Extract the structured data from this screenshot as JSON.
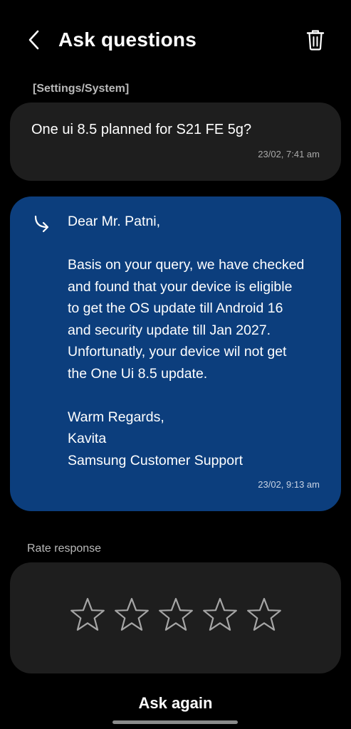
{
  "header": {
    "title": "Ask questions",
    "back_icon": "chevron-left-icon",
    "delete_icon": "trash-icon"
  },
  "question": {
    "category": "[Settings/System]",
    "text": "One ui 8.5 planned for S21 FE 5g?",
    "timestamp": "23/02, 7:41 am"
  },
  "answer": {
    "icon": "reply-arrow-icon",
    "greeting": "Dear Mr. Patni,",
    "body_lines": [
      "Basis on your query, we have checked",
      "and found that your device is eligible",
      "to get the OS update till Android 16",
      "and security update till Jan 2027.",
      "Unfortunatly, your device wil not get",
      "the One Ui 8.5 update."
    ],
    "closing": "Warm Regards,",
    "signature_name": "Kavita",
    "signature_org": "Samsung Customer Support",
    "timestamp": "23/02, 9:13 am",
    "background_color": "#0c3e7d"
  },
  "rating": {
    "label": "Rate response",
    "max_stars": 5,
    "current_rating": 0
  },
  "footer": {
    "ask_again_label": "Ask again"
  },
  "colors": {
    "background": "#000000",
    "card": "#1e1e1e",
    "answer_card": "#0c3e7d",
    "muted_text": "#b9b9b9"
  }
}
